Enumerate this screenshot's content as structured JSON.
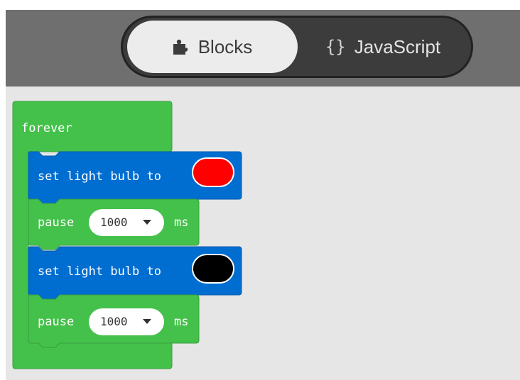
{
  "tabs": {
    "blocks": {
      "label": "Blocks",
      "icon": "puzzle-piece-icon",
      "active": true
    },
    "javascript": {
      "label": "JavaScript",
      "icon_text": "{}",
      "icon": "curly-braces-icon",
      "active": false
    }
  },
  "workspace": {
    "forever_label": "forever",
    "statements": [
      {
        "type": "set_light",
        "label": "set light bulb to",
        "color": "#ff0000"
      },
      {
        "type": "pause",
        "label": "pause",
        "value": "1000",
        "unit": "ms"
      },
      {
        "type": "set_light",
        "label": "set light bulb to",
        "color": "#000000"
      },
      {
        "type": "pause",
        "label": "pause",
        "value": "1000",
        "unit": "ms"
      }
    ]
  },
  "colors": {
    "loop_block": "#44c14a",
    "light_block": "#006dd0",
    "toolbar": "#6f6f6f",
    "canvas": "#e6e6e6"
  }
}
